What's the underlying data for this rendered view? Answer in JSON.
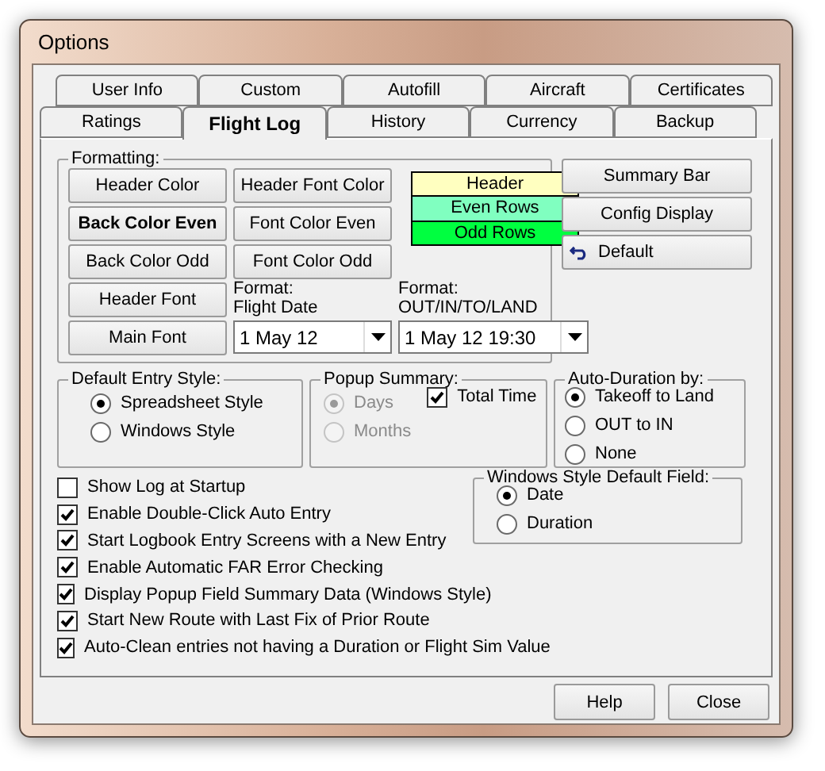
{
  "window": {
    "title": "Options"
  },
  "tab_rows": [
    [
      {
        "label": "User Info",
        "selected": false
      },
      {
        "label": "Custom",
        "selected": false
      },
      {
        "label": "Autofill",
        "selected": false
      },
      {
        "label": "Aircraft",
        "selected": false
      },
      {
        "label": "Certificates",
        "selected": false
      }
    ],
    [
      {
        "label": "Ratings",
        "selected": false
      },
      {
        "label": "Flight Log",
        "selected": true
      },
      {
        "label": "History",
        "selected": false
      },
      {
        "label": "Currency",
        "selected": false
      },
      {
        "label": "Backup",
        "selected": false
      }
    ]
  ],
  "formatting": {
    "title": "Formatting:",
    "buttons": [
      {
        "label": "Header Color",
        "bold": false
      },
      {
        "label": "Header Font Color",
        "bold": false
      },
      {
        "label": "Back Color Even",
        "bold": true
      },
      {
        "label": "Font Color Even",
        "bold": false
      },
      {
        "label": "Back Color Odd",
        "bold": false
      },
      {
        "label": "Font Color Odd",
        "bold": false
      },
      {
        "label": "Header Font",
        "bold": false
      },
      {
        "label": "Main Font",
        "bold": false
      }
    ],
    "color_rows": [
      {
        "label": "Header",
        "color": "#ffffc0"
      },
      {
        "label": "Even Rows",
        "color": "#80ffc0"
      },
      {
        "label": "Odd Rows",
        "color": "#00ff40"
      }
    ],
    "date_format": {
      "label": "Format:",
      "sublabel": "Flight Date",
      "value": "1 May 12"
    },
    "time_format": {
      "label": "Format:",
      "sublabel": "OUT/IN/TO/LAND",
      "value": "1 May 12 19:30"
    }
  },
  "side_buttons": [
    {
      "label": "Summary Bar",
      "kind": "plain"
    },
    {
      "label": "Config Display",
      "kind": "plain"
    },
    {
      "label": "Default",
      "kind": "undo"
    }
  ],
  "default_entry_style": {
    "title": "Default Entry Style:",
    "options": [
      {
        "label": "Spreadsheet Style",
        "selected": true,
        "disabled": false
      },
      {
        "label": "Windows Style",
        "selected": false,
        "disabled": false
      }
    ]
  },
  "popup_summary": {
    "title": "Popup Summary:",
    "options": [
      {
        "label": "Days",
        "selected": true,
        "disabled": true
      },
      {
        "label": "Months",
        "selected": false,
        "disabled": true
      }
    ],
    "total_time": {
      "label": "Total Time",
      "checked": true
    }
  },
  "auto_duration": {
    "title": "Auto-Duration by:",
    "options": [
      {
        "label": "Takeoff to Land",
        "selected": true,
        "disabled": false
      },
      {
        "label": "OUT to IN",
        "selected": false,
        "disabled": false
      },
      {
        "label": "None",
        "selected": false,
        "disabled": false
      }
    ]
  },
  "checkboxes": [
    {
      "label": "Show Log at Startup",
      "checked": false
    },
    {
      "label": "Enable Double-Click Auto Entry",
      "checked": true
    },
    {
      "label": "Start Logbook Entry Screens with a New Entry",
      "checked": true
    },
    {
      "label": "Enable Automatic FAR Error Checking",
      "checked": true
    },
    {
      "label": "Display Popup Field Summary Data (Windows Style)",
      "checked": true
    },
    {
      "label": "Start New Route with Last Fix of Prior Route",
      "checked": true
    },
    {
      "label": "Auto-Clean entries not having a Duration or Flight Sim Value",
      "checked": true
    }
  ],
  "windows_default_field": {
    "title": "Windows Style Default Field:",
    "options": [
      {
        "label": "Date",
        "selected": true,
        "disabled": false
      },
      {
        "label": "Duration",
        "selected": false,
        "disabled": false
      }
    ]
  },
  "footer_buttons": [
    {
      "label": "Help"
    },
    {
      "label": "Close"
    }
  ]
}
